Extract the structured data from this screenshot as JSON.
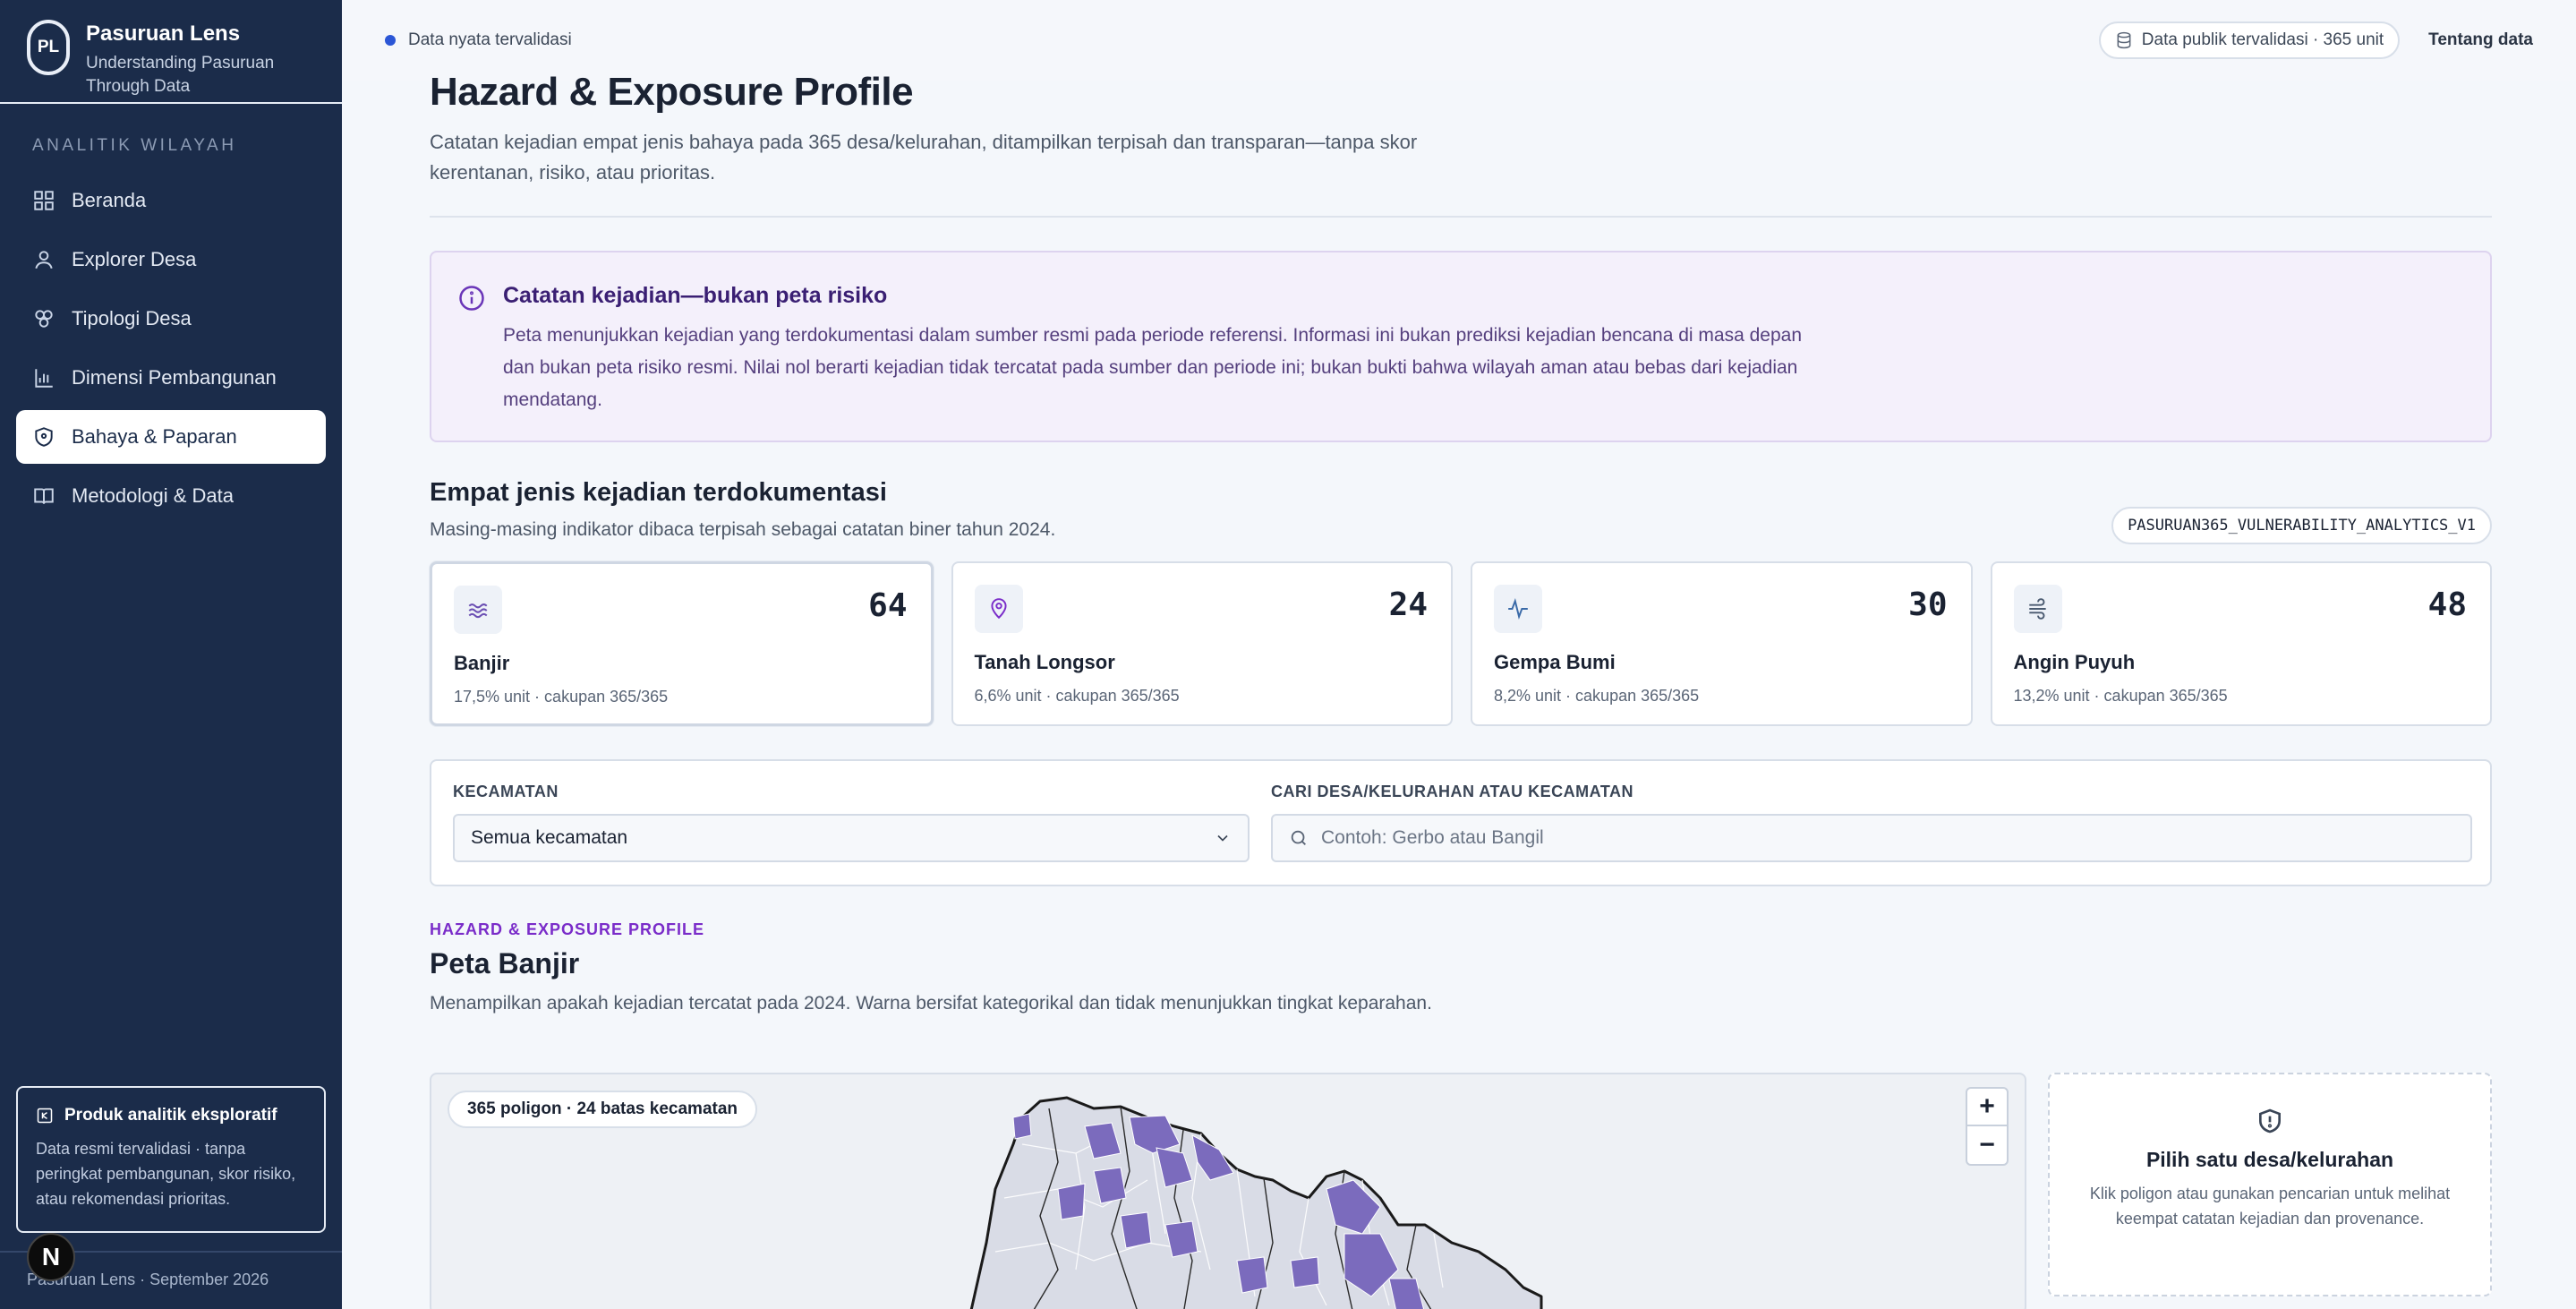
{
  "brand": {
    "logo": "PL",
    "title": "Pasuruan Lens",
    "subtitle": "Understanding Pasuruan Through Data"
  },
  "sidebar": {
    "section_label": "ANALITIK WILAYAH",
    "items": [
      {
        "label": "Beranda",
        "icon": "grid-icon"
      },
      {
        "label": "Explorer Desa",
        "icon": "person-icon"
      },
      {
        "label": "Tipologi Desa",
        "icon": "cluster-icon"
      },
      {
        "label": "Dimensi Pembangunan",
        "icon": "bar-chart-icon"
      },
      {
        "label": "Bahaya & Paparan",
        "icon": "shield-icon",
        "active": true
      },
      {
        "label": "Metodologi & Data",
        "icon": "book-icon"
      }
    ],
    "card": {
      "title": "Produk analitik eksploratif",
      "text": "Data resmi tervalidasi · tanpa peringkat pembangunan, skor risiko, atau rekomendasi prioritas."
    },
    "footer": "Pasuruan Lens · September 2026",
    "badge": "N"
  },
  "topbar": {
    "status": "Data nyata tervalidasi",
    "data_pill": "Data publik tervalidasi · 365 unit",
    "about": "Tentang data"
  },
  "page": {
    "title": "Hazard & Exposure Profile",
    "description": "Catatan kejadian empat jenis bahaya pada 365 desa/kelurahan, ditampilkan terpisah dan transparan—tanpa skor kerentanan, risiko, atau prioritas."
  },
  "notice": {
    "title": "Catatan kejadian—bukan peta risiko",
    "text": "Peta menunjukkan kejadian yang terdokumentasi dalam sumber resmi pada periode referensi. Informasi ini bukan prediksi kejadian bencana di masa depan dan bukan peta risiko resmi. Nilai nol berarti kejadian tidak tercatat pada sumber dan periode ini; bukan bukti bahwa wilayah aman atau bebas dari kejadian mendatang."
  },
  "events": {
    "title": "Empat jenis kejadian terdokumentasi",
    "description": "Masing-masing indikator dibaca terpisah sebagai catatan biner tahun 2024.",
    "dataset_code": "PASURUAN365_VULNERABILITY_ANALYTICS_V1",
    "cards": [
      {
        "label": "Banjir",
        "value": "64",
        "meta": "17,5% unit · cakupan 365/365",
        "icon": "wave-icon",
        "color": "#6b4fb3"
      },
      {
        "label": "Tanah Longsor",
        "value": "24",
        "meta": "6,6% unit · cakupan 365/365",
        "icon": "map-pin-icon",
        "color": "#7a2cc9"
      },
      {
        "label": "Gempa Bumi",
        "value": "30",
        "meta": "8,2% unit · cakupan 365/365",
        "icon": "pulse-icon",
        "color": "#3a6aa8"
      },
      {
        "label": "Angin Puyuh",
        "value": "48",
        "meta": "13,2% unit · cakupan 365/365",
        "icon": "wind-icon",
        "color": "#4a5a70"
      }
    ]
  },
  "filters": {
    "district_label": "KECAMATAN",
    "district_value": "Semua kecamatan",
    "search_label": "CARI DESA/KELURAHAN ATAU KECAMATAN",
    "search_placeholder": "Contoh: Gerbo atau Bangil"
  },
  "map": {
    "eyebrow": "HAZARD & EXPOSURE PROFILE",
    "title": "Peta Banjir",
    "description": "Menampilkan apakah kejadian tercatat pada 2024. Warna bersifat kategorikal dan tidak menunjukkan tingkat keparahan.",
    "pill": "365 poligon · 24 batas kecamatan",
    "zoom_in": "+",
    "zoom_out": "−",
    "event_color": "#7b6bbd",
    "base_color": "#d9dce6"
  },
  "detail": {
    "title": "Pilih satu desa/kelurahan",
    "text": "Klik poligon atau gunakan pencarian untuk melihat keempat catatan kejadian dan provenance."
  }
}
